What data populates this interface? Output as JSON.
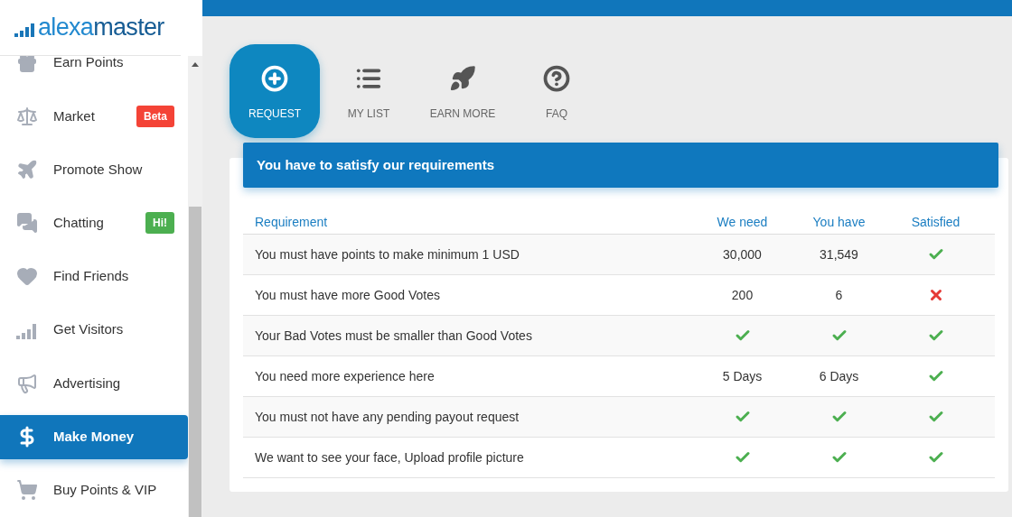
{
  "logo": {
    "text_light": "alexa",
    "text_dark": "master"
  },
  "sidebar": {
    "items": [
      {
        "label": "Earn Points",
        "kind": "gift",
        "selected": false
      },
      {
        "label": "Market",
        "kind": "scale",
        "selected": false,
        "badge": {
          "text": "Beta",
          "color": "#f44336"
        }
      },
      {
        "label": "Promote Show",
        "kind": "plane",
        "selected": false
      },
      {
        "label": "Chatting",
        "kind": "chat",
        "selected": false,
        "badge": {
          "text": "Hi!",
          "color": "#4caf50"
        }
      },
      {
        "label": "Find Friends",
        "kind": "heart",
        "selected": false
      },
      {
        "label": "Get Visitors",
        "kind": "signal",
        "selected": false
      },
      {
        "label": "Advertising",
        "kind": "ad",
        "selected": false
      },
      {
        "label": "Make Money",
        "kind": "dollar",
        "selected": true
      },
      {
        "label": "Buy Points & VIP",
        "kind": "cart",
        "selected": false
      }
    ]
  },
  "tabs": [
    {
      "label": "REQUEST",
      "kind": "plus",
      "selected": true
    },
    {
      "label": "MY LIST",
      "kind": "list",
      "selected": false
    },
    {
      "label": "EARN MORE",
      "kind": "rocket",
      "selected": false
    },
    {
      "label": "FAQ",
      "kind": "question",
      "selected": false
    }
  ],
  "panel": {
    "title": "You have to satisfy our requirements",
    "table": {
      "columns": [
        "Requirement",
        "We need",
        "You have",
        "Satisfied"
      ],
      "rows": [
        {
          "cells": [
            {
              "kind": "text",
              "text": "You must have points to make minimum 1 USD"
            },
            {
              "kind": "text",
              "text": "30,000"
            },
            {
              "kind": "text",
              "text": "31,549"
            },
            {
              "kind": "check"
            }
          ]
        },
        {
          "cells": [
            {
              "kind": "text",
              "text": "You must have more Good Votes"
            },
            {
              "kind": "text",
              "text": "200"
            },
            {
              "kind": "text",
              "text": "6"
            },
            {
              "kind": "cross"
            }
          ]
        },
        {
          "cells": [
            {
              "kind": "text",
              "text": "Your Bad Votes must be smaller than Good Votes"
            },
            {
              "kind": "check"
            },
            {
              "kind": "check"
            },
            {
              "kind": "check"
            }
          ]
        },
        {
          "cells": [
            {
              "kind": "text",
              "text": "You need more experience here"
            },
            {
              "kind": "text",
              "text": "5 Days"
            },
            {
              "kind": "text",
              "text": "6 Days"
            },
            {
              "kind": "check"
            }
          ]
        },
        {
          "cells": [
            {
              "kind": "text",
              "text": "You must not have any pending payout request"
            },
            {
              "kind": "check"
            },
            {
              "kind": "check"
            },
            {
              "kind": "check"
            }
          ]
        },
        {
          "cells": [
            {
              "kind": "text",
              "text": "We want to see your face, Upload profile picture"
            },
            {
              "kind": "check"
            },
            {
              "kind": "check"
            },
            {
              "kind": "check"
            }
          ]
        }
      ]
    }
  }
}
